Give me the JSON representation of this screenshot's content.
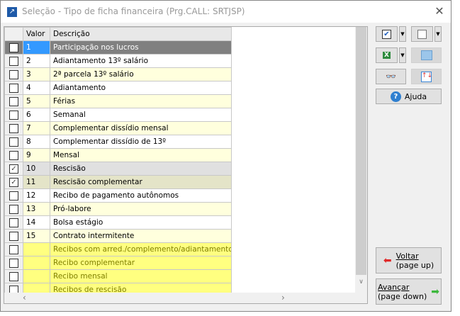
{
  "window": {
    "title": "Seleção - Tipo de ficha financeira (Prg.CALL: SRTJSP)"
  },
  "grid": {
    "columns": [
      "Valor",
      "Descrição"
    ],
    "rows": [
      {
        "checked": false,
        "valor": "1",
        "descricao": "Participação nos lucros",
        "style": "sel"
      },
      {
        "checked": false,
        "valor": "2",
        "descricao": "Adiantamento 13º salário",
        "style": "w"
      },
      {
        "checked": false,
        "valor": "3",
        "descricao": "2ª parcela 13º salário",
        "style": "y"
      },
      {
        "checked": false,
        "valor": "4",
        "descricao": "Adiantamento",
        "style": "w"
      },
      {
        "checked": false,
        "valor": "5",
        "descricao": "Férias",
        "style": "y"
      },
      {
        "checked": false,
        "valor": "6",
        "descricao": "Semanal",
        "style": "w"
      },
      {
        "checked": false,
        "valor": "7",
        "descricao": "Complementar dissídio mensal",
        "style": "y"
      },
      {
        "checked": false,
        "valor": "8",
        "descricao": "Complementar dissídio de 13º",
        "style": "w"
      },
      {
        "checked": false,
        "valor": "9",
        "descricao": "Mensal",
        "style": "y"
      },
      {
        "checked": true,
        "valor": "10",
        "descricao": "Rescisão",
        "style": "g"
      },
      {
        "checked": true,
        "valor": "11",
        "descricao": "Rescisão complementar",
        "style": "o"
      },
      {
        "checked": false,
        "valor": "12",
        "descricao": "Recibo de pagamento autônomos",
        "style": "w"
      },
      {
        "checked": false,
        "valor": "13",
        "descricao": "Pró-labore",
        "style": "y"
      },
      {
        "checked": false,
        "valor": "14",
        "descricao": "Bolsa estágio",
        "style": "w"
      },
      {
        "checked": false,
        "valor": "15",
        "descricao": "Contrato intermitente",
        "style": "y"
      },
      {
        "checked": false,
        "valor": "",
        "descricao": "Recibos com arred./complemento/adiantamento sal",
        "style": "x"
      },
      {
        "checked": false,
        "valor": "",
        "descricao": "Recibo complementar",
        "style": "x"
      },
      {
        "checked": false,
        "valor": "",
        "descricao": "Recibo mensal",
        "style": "x"
      },
      {
        "checked": false,
        "valor": "",
        "descricao": "Recibos de rescisão",
        "style": "x"
      }
    ]
  },
  "buttons": {
    "help": "Ajuda",
    "back_line1": "Voltar",
    "back_line2": "(page up)",
    "next_line1": "Avançar",
    "next_line2": "(page down)"
  }
}
